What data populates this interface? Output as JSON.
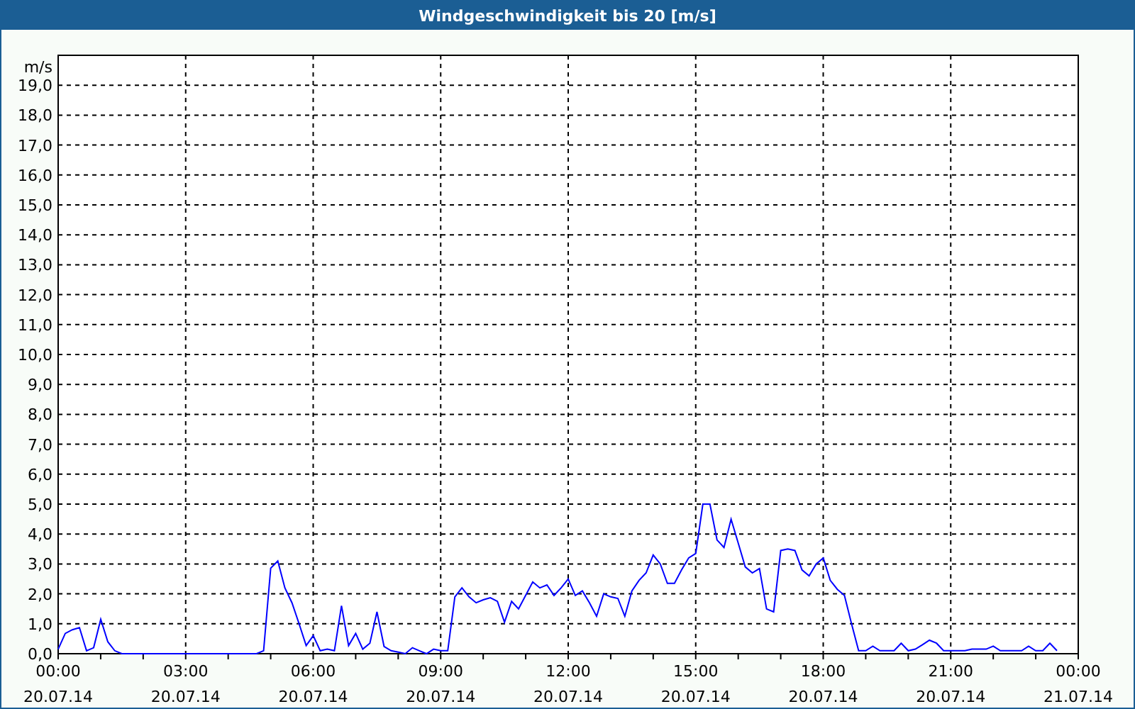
{
  "window": {
    "title": "Windgeschwindigkeit bis 20 [m/s]"
  },
  "chart_data": {
    "type": "line",
    "grid": true,
    "ylabel": "m/s",
    "ylim": [
      0,
      20
    ],
    "yticks": [
      {
        "value": 0,
        "label": "0,0"
      },
      {
        "value": 1,
        "label": "1,0"
      },
      {
        "value": 2,
        "label": "2,0"
      },
      {
        "value": 3,
        "label": "3,0"
      },
      {
        "value": 4,
        "label": "4,0"
      },
      {
        "value": 5,
        "label": "5,0"
      },
      {
        "value": 6,
        "label": "6,0"
      },
      {
        "value": 7,
        "label": "7,0"
      },
      {
        "value": 8,
        "label": "8,0"
      },
      {
        "value": 9,
        "label": "9,0"
      },
      {
        "value": 10,
        "label": "10,0"
      },
      {
        "value": 11,
        "label": "11,0"
      },
      {
        "value": 12,
        "label": "12,0"
      },
      {
        "value": 13,
        "label": "13,0"
      },
      {
        "value": 14,
        "label": "14,0"
      },
      {
        "value": 15,
        "label": "15,0"
      },
      {
        "value": 16,
        "label": "16,0"
      },
      {
        "value": 17,
        "label": "17,0"
      },
      {
        "value": 18,
        "label": "18,0"
      },
      {
        "value": 19,
        "label": "19,0"
      }
    ],
    "categories": [
      "00:00 20.07.14",
      null,
      null,
      null,
      null,
      null,
      null,
      null,
      null,
      null,
      null,
      null,
      null,
      null,
      null,
      null,
      null,
      null,
      "03:00 20.07.14",
      null,
      null,
      null,
      null,
      null,
      null,
      null,
      null,
      null,
      null,
      null,
      null,
      null,
      null,
      null,
      null,
      null,
      "06:00 20.07.14",
      null,
      null,
      null,
      null,
      null,
      null,
      null,
      null,
      null,
      null,
      null,
      null,
      null,
      null,
      null,
      null,
      null,
      "09:00 20.07.14",
      null,
      null,
      null,
      null,
      null,
      null,
      null,
      null,
      null,
      null,
      null,
      null,
      null,
      null,
      null,
      null,
      null,
      "12:00 20.07.14",
      null,
      null,
      null,
      null,
      null,
      null,
      null,
      null,
      null,
      null,
      null,
      null,
      null,
      null,
      null,
      null,
      null,
      "15:00 20.07.14",
      null,
      null,
      null,
      null,
      null,
      null,
      null,
      null,
      null,
      null,
      null,
      null,
      null,
      null,
      null,
      null,
      null,
      "18:00 20.07.14",
      null,
      null,
      null,
      null,
      null,
      null,
      null,
      null,
      null,
      null,
      null,
      null,
      null,
      null,
      null,
      null,
      null,
      "21:00 20.07.14",
      null,
      null,
      null,
      null,
      null,
      null,
      null,
      null,
      null,
      null,
      null,
      null,
      null,
      null,
      null,
      null,
      null,
      "00:00 21.07.14"
    ],
    "series": [
      {
        "color": "#0000ff",
        "values": [
          0.15,
          0.68,
          0.8,
          0.87,
          0.1,
          0.2,
          1.15,
          0.4,
          0.1,
          0,
          0,
          0,
          0,
          0,
          0,
          0,
          0,
          0,
          0,
          0,
          0,
          0,
          0,
          0,
          0,
          0,
          0,
          0,
          0,
          0.1,
          2.86,
          3.1,
          2.2,
          1.7,
          1.0,
          0.27,
          0.6,
          0.1,
          0.15,
          0.1,
          1.6,
          0.27,
          0.68,
          0.15,
          0.35,
          1.4,
          0.24,
          0.1,
          0.05,
          0,
          0.2,
          0.1,
          0,
          0.15,
          0.1,
          0.1,
          1.9,
          2.2,
          1.9,
          1.7,
          1.8,
          1.87,
          1.75,
          1.05,
          1.75,
          1.5,
          1.95,
          2.4,
          2.2,
          2.3,
          1.95,
          2.2,
          2.5,
          1.95,
          2.1,
          1.7,
          1.25,
          2.0,
          1.9,
          1.85,
          1.25,
          2.1,
          2.45,
          2.7,
          3.3,
          3.0,
          2.35,
          2.35,
          2.8,
          3.2,
          3.35,
          5.0,
          5.0,
          3.8,
          3.55,
          4.5,
          3.7,
          2.9,
          2.7,
          2.85,
          1.5,
          1.4,
          3.45,
          3.5,
          3.45,
          2.8,
          2.6,
          3.0,
          3.2,
          2.45,
          2.15,
          1.95,
          1.0,
          0.1,
          0.1,
          0.25,
          0.1,
          0.1,
          0.1,
          0.35,
          0.1,
          0.15,
          0.3,
          0.45,
          0.35,
          0.1,
          0.1,
          0.1,
          0.1,
          0.15,
          0.15,
          0.15,
          0.25,
          0.1,
          0.1,
          0.1,
          0.1,
          0.25,
          0.1,
          0.1,
          0.35,
          0.1,
          null,
          null,
          null
        ]
      }
    ]
  }
}
